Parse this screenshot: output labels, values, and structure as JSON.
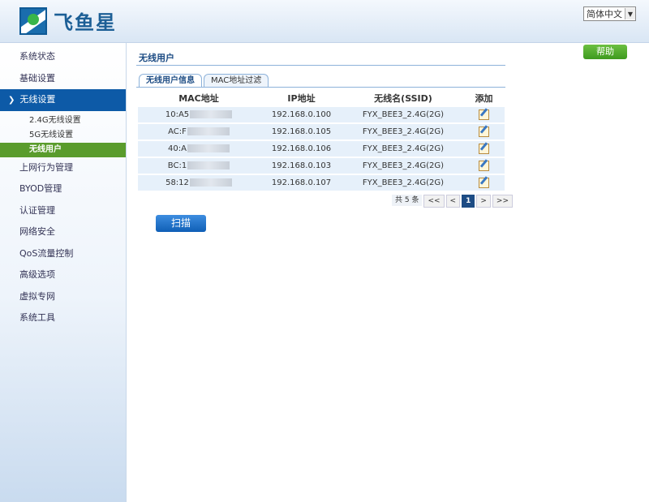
{
  "header": {
    "brand": "飞鱼星",
    "language": "简体中文"
  },
  "sidebar": {
    "items": [
      {
        "label": "系统状态"
      },
      {
        "label": "基础设置"
      },
      {
        "label": "无线设置",
        "active": true
      },
      {
        "label": "上网行为管理"
      },
      {
        "label": "BYOD管理"
      },
      {
        "label": "认证管理"
      },
      {
        "label": "网络安全"
      },
      {
        "label": "QoS流量控制"
      },
      {
        "label": "高级选项"
      },
      {
        "label": "虚拟专网"
      },
      {
        "label": "系统工具"
      }
    ],
    "subitems": [
      {
        "label": "2.4G无线设置"
      },
      {
        "label": "5G无线设置"
      },
      {
        "label": "无线用户",
        "active": true
      }
    ]
  },
  "main": {
    "help_label": "帮助",
    "title": "无线用户",
    "tabs": [
      {
        "label": "无线用户信息",
        "active": true
      },
      {
        "label": "MAC地址过滤"
      }
    ],
    "columns": [
      "MAC地址",
      "IP地址",
      "无线名(SSID)",
      "添加"
    ],
    "rows": [
      {
        "mac": "10:A5",
        "ip": "192.168.0.100",
        "ssid": "FYX_BEE3_2.4G(2G)"
      },
      {
        "mac": "AC:F",
        "ip": "192.168.0.105",
        "ssid": "FYX_BEE3_2.4G(2G)"
      },
      {
        "mac": "40:A",
        "ip": "192.168.0.106",
        "ssid": "FYX_BEE3_2.4G(2G)"
      },
      {
        "mac": "BC:1",
        "ip": "192.168.0.103",
        "ssid": "FYX_BEE3_2.4G(2G)"
      },
      {
        "mac": "58:12",
        "ip": "192.168.0.107",
        "ssid": "FYX_BEE3_2.4G(2G)"
      }
    ],
    "pager": {
      "total": "共 5 条",
      "first": "<<",
      "prev": "<",
      "current": "1",
      "next": ">",
      "last": ">>"
    },
    "scan_label": "扫描"
  },
  "colors": {
    "nav_active": "#0d5aa7",
    "sub_active": "#5a9c2c",
    "help_button": "#4aa82a",
    "scan_button": "#1f6fcb",
    "row_bg": "#e6f0fa"
  },
  "icons": [
    "logo-icon",
    "chevron-down-icon",
    "dropdown-arrow-icon",
    "edit-icon"
  ]
}
